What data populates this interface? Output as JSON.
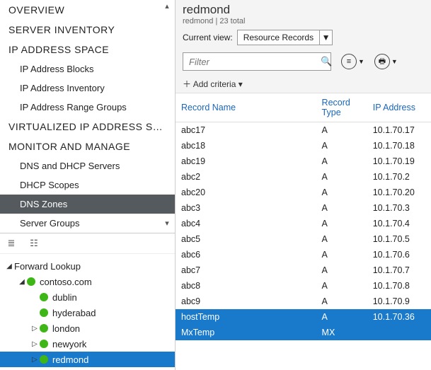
{
  "nav": {
    "items": [
      {
        "label": "OVERVIEW",
        "level": 0
      },
      {
        "label": "SERVER INVENTORY",
        "level": 0
      },
      {
        "label": "IP ADDRESS SPACE",
        "level": 0
      },
      {
        "label": "IP Address Blocks",
        "level": 1
      },
      {
        "label": "IP Address Inventory",
        "level": 1
      },
      {
        "label": "IP Address Range Groups",
        "level": 1
      },
      {
        "label": "VIRTUALIZED IP ADDRESS SPA...",
        "level": 0
      },
      {
        "label": "MONITOR AND MANAGE",
        "level": 0
      },
      {
        "label": "DNS and DHCP Servers",
        "level": 1
      },
      {
        "label": "DHCP Scopes",
        "level": 1
      },
      {
        "label": "DNS Zones",
        "level": 1,
        "selected": true
      },
      {
        "label": "Server Groups",
        "level": 1
      }
    ]
  },
  "tree": {
    "root": {
      "label": "Forward Lookup"
    },
    "domain": {
      "label": "contoso.com"
    },
    "zones": [
      {
        "label": "dublin",
        "exp": ""
      },
      {
        "label": "hyderabad",
        "exp": ""
      },
      {
        "label": "london",
        "exp": "▷"
      },
      {
        "label": "newyork",
        "exp": "▷"
      },
      {
        "label": "redmond",
        "exp": "▷",
        "selected": true
      }
    ]
  },
  "header": {
    "title": "redmond",
    "sub": "redmond | 23 total"
  },
  "view": {
    "label": "Current view:",
    "value": "Resource Records"
  },
  "filter": {
    "placeholder": "Filter"
  },
  "addcriteria": {
    "label": "Add criteria"
  },
  "icons": {
    "list": "≡",
    "save": "🖶"
  },
  "table": {
    "cols": [
      "Record Name",
      "Record Type",
      "IP Address"
    ],
    "rows": [
      {
        "name": "abc17",
        "type": "A",
        "ip": "10.1.70.17"
      },
      {
        "name": "abc18",
        "type": "A",
        "ip": "10.1.70.18"
      },
      {
        "name": "abc19",
        "type": "A",
        "ip": "10.1.70.19"
      },
      {
        "name": "abc2",
        "type": "A",
        "ip": "10.1.70.2"
      },
      {
        "name": "abc20",
        "type": "A",
        "ip": "10.1.70.20"
      },
      {
        "name": "abc3",
        "type": "A",
        "ip": "10.1.70.3"
      },
      {
        "name": "abc4",
        "type": "A",
        "ip": "10.1.70.4"
      },
      {
        "name": "abc5",
        "type": "A",
        "ip": "10.1.70.5"
      },
      {
        "name": "abc6",
        "type": "A",
        "ip": "10.1.70.6"
      },
      {
        "name": "abc7",
        "type": "A",
        "ip": "10.1.70.7"
      },
      {
        "name": "abc8",
        "type": "A",
        "ip": "10.1.70.8"
      },
      {
        "name": "abc9",
        "type": "A",
        "ip": "10.1.70.9"
      },
      {
        "name": "hostTemp",
        "type": "A",
        "ip": "10.1.70.36",
        "sel": true
      },
      {
        "name": "MxTemp",
        "type": "MX",
        "ip": "",
        "sel": true
      }
    ]
  }
}
